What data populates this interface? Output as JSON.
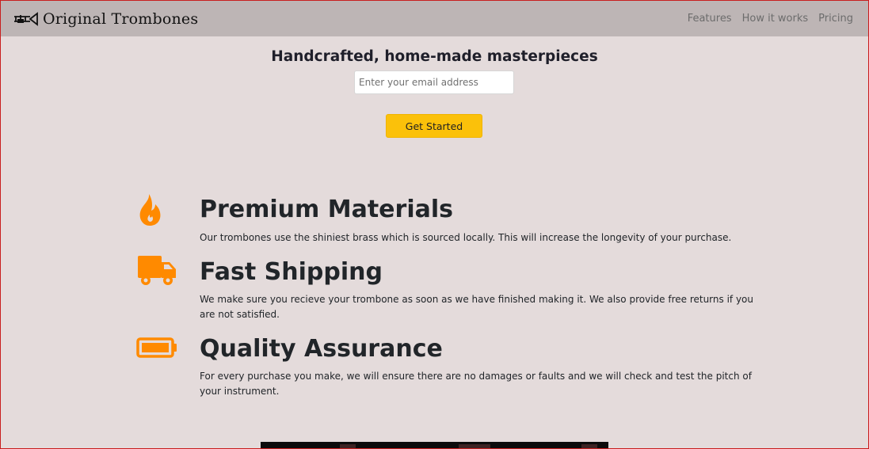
{
  "header": {
    "brand": "Original Trombones",
    "logo_icon": "trombone-icon",
    "nav": [
      {
        "label": "Features"
      },
      {
        "label": "How it works"
      },
      {
        "label": "Pricing"
      }
    ]
  },
  "hero": {
    "title": "Handcrafted, home-made masterpieces",
    "email_placeholder": "Enter your email address",
    "cta_label": "Get Started"
  },
  "features": [
    {
      "icon": "fire-icon",
      "title": "Premium Materials",
      "text": "Our trombones use the shiniest brass which is sourced locally. This will increase the longevity of your purchase."
    },
    {
      "icon": "truck-icon",
      "title": "Fast Shipping",
      "text": "We make sure you recieve your trombone as soon as we have finished making it. We also provide free returns if you are not satisfied."
    },
    {
      "icon": "battery-icon",
      "title": "Quality Assurance",
      "text": "For every purchase you make, we will ensure there are no damages or faults and we will check and test the pitch of your instrument."
    }
  ],
  "colors": {
    "accent_orange": "#ff8a00",
    "cta_yellow": "#fbc10a",
    "header_bg": "#bdb5b5",
    "page_bg": "#e4dbdb"
  }
}
